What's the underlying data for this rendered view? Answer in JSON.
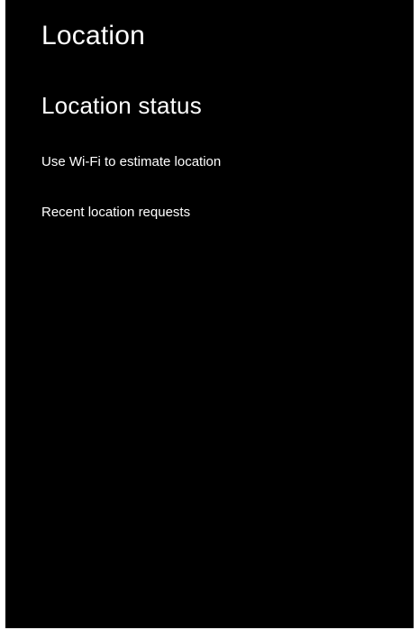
{
  "page": {
    "title": "Location"
  },
  "section": {
    "title": "Location status"
  },
  "menu": {
    "items": [
      {
        "label": "Use Wi-Fi to estimate location"
      },
      {
        "label": "Recent location requests"
      }
    ]
  },
  "colors": {
    "background": "#000000",
    "text": "#ffffff",
    "border": "#ffffff"
  }
}
